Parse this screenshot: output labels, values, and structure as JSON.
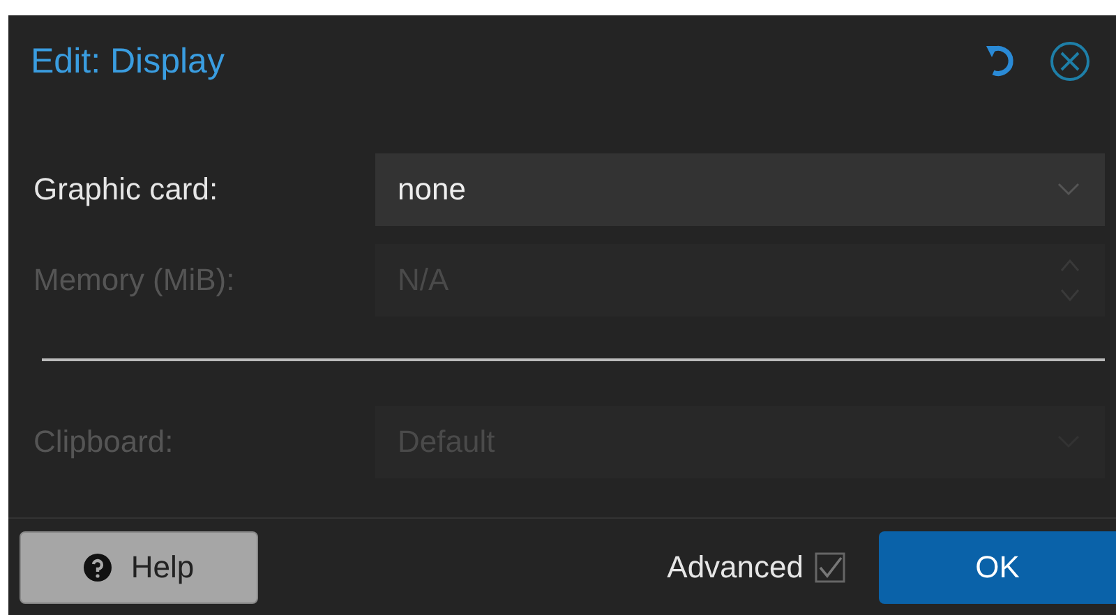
{
  "window": {
    "title": "Edit: Display"
  },
  "fields": [
    {
      "label": "Graphic card:",
      "value": "none",
      "kind": "combo",
      "disabled": false
    },
    {
      "label": "Memory (MiB):",
      "value": "N/A",
      "kind": "spinner",
      "disabled": true
    }
  ],
  "advanced_fields": [
    {
      "label": "Clipboard:",
      "value": "Default",
      "kind": "combo",
      "disabled": true
    }
  ],
  "footer": {
    "help": "Help",
    "advanced": {
      "label": "Advanced",
      "checked": true
    },
    "ok": "OK"
  }
}
